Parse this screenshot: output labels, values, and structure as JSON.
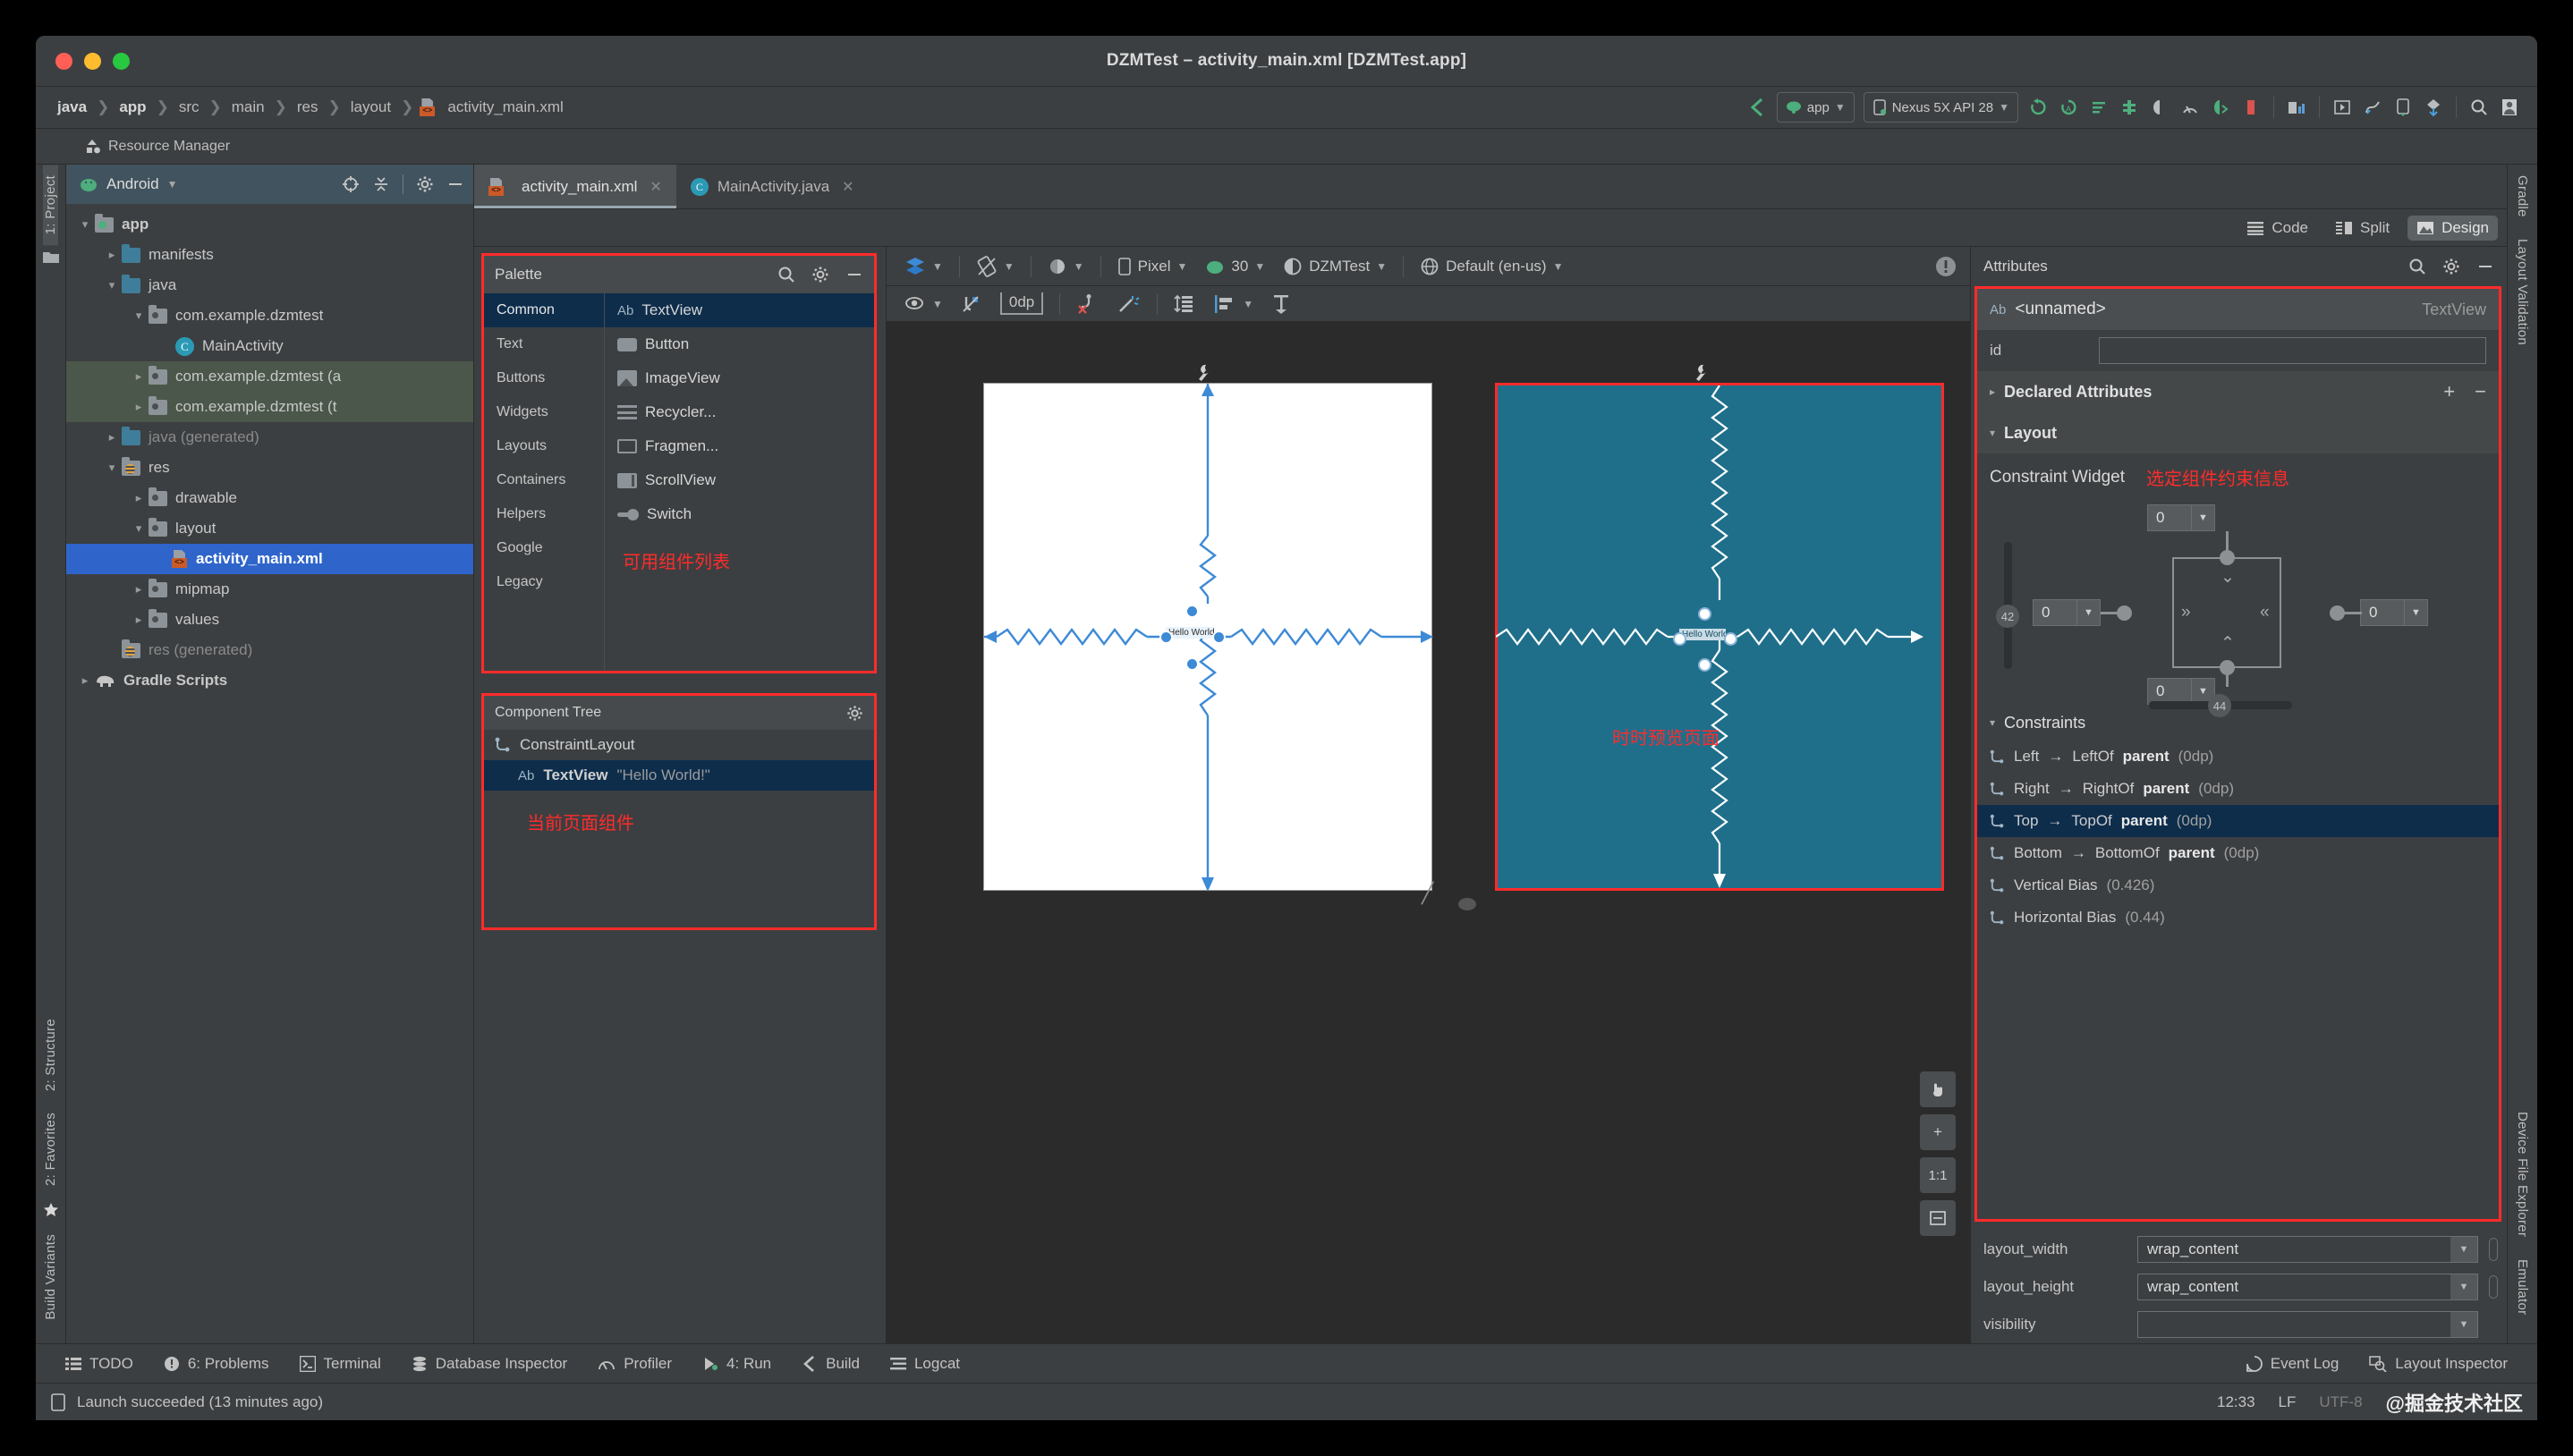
{
  "window": {
    "title": "DZMTest – activity_main.xml [DZMTest.app]"
  },
  "breadcrumb": {
    "items": [
      "java",
      "app",
      "src",
      "main",
      "res",
      "layout",
      "activity_main.xml"
    ]
  },
  "main_toolbar": {
    "module_selector": "app",
    "device_selector": "Nexus 5X API 28"
  },
  "resource_manager": {
    "label": "Resource Manager"
  },
  "project_panel": {
    "title": "Android",
    "tree": [
      {
        "label": "app",
        "indent": 0,
        "chevron": "down",
        "icon": "module-folder",
        "bold": true
      },
      {
        "label": "manifests",
        "indent": 1,
        "chevron": "right",
        "icon": "folder-blue"
      },
      {
        "label": "java",
        "indent": 1,
        "chevron": "down",
        "icon": "folder-blue"
      },
      {
        "label": "com.example.dzmtest",
        "indent": 2,
        "chevron": "down",
        "icon": "package"
      },
      {
        "label": "MainActivity",
        "indent": 3,
        "chevron": "none",
        "icon": "class"
      },
      {
        "label": "com.example.dzmtest (a",
        "indent": 2,
        "chevron": "right",
        "icon": "package",
        "vcs": true
      },
      {
        "label": "com.example.dzmtest (t",
        "indent": 2,
        "chevron": "right",
        "icon": "package",
        "vcs": true
      },
      {
        "label": "java (generated)",
        "indent": 1,
        "chevron": "right",
        "icon": "folder-gen",
        "dim": true
      },
      {
        "label": "res",
        "indent": 1,
        "chevron": "down",
        "icon": "folder-res"
      },
      {
        "label": "drawable",
        "indent": 2,
        "chevron": "right",
        "icon": "package"
      },
      {
        "label": "layout",
        "indent": 2,
        "chevron": "down",
        "icon": "package"
      },
      {
        "label": "activity_main.xml",
        "indent": 3,
        "chevron": "none",
        "icon": "xml",
        "selected": true
      },
      {
        "label": "mipmap",
        "indent": 2,
        "chevron": "right",
        "icon": "package"
      },
      {
        "label": "values",
        "indent": 2,
        "chevron": "right",
        "icon": "package"
      },
      {
        "label": "res (generated)",
        "indent": 1,
        "chevron": "none",
        "icon": "folder-res",
        "dim": true
      },
      {
        "label": "Gradle Scripts",
        "indent": 0,
        "chevron": "right",
        "icon": "gradle"
      }
    ]
  },
  "left_rail": {
    "tabs": [
      "1: Project",
      "2: Structure",
      "2: Favorites",
      "Build Variants"
    ]
  },
  "right_rail": {
    "tabs": [
      "Gradle",
      "Layout Validation",
      "Device File Explorer",
      "Emulator"
    ]
  },
  "editor_tabs": [
    {
      "label": "activity_main.xml",
      "icon": "xml-file-icon",
      "active": true
    },
    {
      "label": "MainActivity.java",
      "icon": "java-class-icon",
      "active": false
    }
  ],
  "view_modes": [
    {
      "label": "Code",
      "icon": "code-lines-icon",
      "active": false
    },
    {
      "label": "Split",
      "icon": "split-view-icon",
      "active": false
    },
    {
      "label": "Design",
      "icon": "design-image-icon",
      "active": true
    }
  ],
  "palette": {
    "title": "Palette",
    "annotation": "可用组件列表",
    "categories": [
      {
        "label": "Common",
        "active": true
      },
      {
        "label": "Text",
        "active": false
      },
      {
        "label": "Buttons",
        "active": false
      },
      {
        "label": "Widgets",
        "active": false
      },
      {
        "label": "Layouts",
        "active": false
      },
      {
        "label": "Containers",
        "active": false
      },
      {
        "label": "Helpers",
        "active": false
      },
      {
        "label": "Google",
        "active": false
      },
      {
        "label": "Legacy",
        "active": false
      }
    ],
    "items": [
      {
        "label": "TextView",
        "icon": "ab-text-icon",
        "active": true
      },
      {
        "label": "Button",
        "icon": "button-icon",
        "active": false
      },
      {
        "label": "ImageView",
        "icon": "image-icon",
        "active": false
      },
      {
        "label": "Recycler...",
        "icon": "list-icon",
        "active": false
      },
      {
        "label": "Fragmen...",
        "icon": "frame-icon",
        "active": false
      },
      {
        "label": "ScrollView",
        "icon": "scroll-icon",
        "active": false
      },
      {
        "label": "Switch",
        "icon": "switch-icon",
        "active": false
      }
    ]
  },
  "component_tree": {
    "title": "Component Tree",
    "annotation": "当前页面组件",
    "nodes": [
      {
        "label": "ConstraintLayout",
        "value": "",
        "icon": "constraint-icon",
        "indent": 0,
        "selected": false
      },
      {
        "label": "TextView",
        "value": "\"Hello World!\"",
        "icon": "ab-text-icon",
        "indent": 1,
        "selected": true
      }
    ]
  },
  "design_toolbar": {
    "device": "Pixel",
    "api_level": "30",
    "theme": "DZMTest",
    "locale": "Default (en-us)",
    "margin_value": "0dp"
  },
  "design_canvas": {
    "annotation": "时时预览页面",
    "textview_label": "Hello World!"
  },
  "attributes": {
    "title": "Attributes",
    "component_name": "<unnamed>",
    "component_type": "TextView",
    "id_label": "id",
    "id_value": "",
    "declared_attributes_label": "Declared Attributes",
    "layout_section_label": "Layout",
    "constraint_widget_label": "Constraint Widget",
    "constraint_annotation": "选定组件约束信息",
    "margins": {
      "top": "0",
      "left": "0",
      "right": "0",
      "bottom": "0"
    },
    "vertical_bias": "42",
    "horizontal_bias": "44",
    "constraints_label": "Constraints",
    "constraints": [
      {
        "side": "Left",
        "target": "LeftOf",
        "parent": "parent",
        "value": "(0dp)",
        "selected": false
      },
      {
        "side": "Right",
        "target": "RightOf",
        "parent": "parent",
        "value": "(0dp)",
        "selected": false
      },
      {
        "side": "Top",
        "target": "TopOf",
        "parent": "parent",
        "value": "(0dp)",
        "selected": true
      },
      {
        "side": "Bottom",
        "target": "BottomOf",
        "parent": "parent",
        "value": "(0dp)",
        "selected": false
      },
      {
        "side": "Vertical Bias",
        "target": "",
        "parent": "",
        "value": "(0.426)",
        "selected": false
      },
      {
        "side": "Horizontal Bias",
        "target": "",
        "parent": "",
        "value": "(0.44)",
        "selected": false
      }
    ],
    "properties": [
      {
        "name": "layout_width",
        "value": "wrap_content",
        "has_pill": true
      },
      {
        "name": "layout_height",
        "value": "wrap_content",
        "has_pill": true
      },
      {
        "name": "visibility",
        "value": "",
        "has_pill": false
      }
    ]
  },
  "tool_windows": [
    {
      "label": "TODO",
      "icon": "todo-icon"
    },
    {
      "label": "6: Problems",
      "icon": "problems-icon",
      "mnemonic": "6"
    },
    {
      "label": "Terminal",
      "icon": "terminal-icon"
    },
    {
      "label": "Database Inspector",
      "icon": "database-icon"
    },
    {
      "label": "Profiler",
      "icon": "profiler-icon"
    },
    {
      "label": "4: Run",
      "icon": "run-icon",
      "mnemonic": "4"
    },
    {
      "label": "Build",
      "icon": "build-icon"
    },
    {
      "label": "Logcat",
      "icon": "logcat-icon"
    }
  ],
  "tool_windows_right": [
    {
      "label": "Event Log",
      "icon": "event-log-icon"
    },
    {
      "label": "Layout Inspector",
      "icon": "layout-inspector-icon"
    }
  ],
  "status_bar": {
    "message": "Launch succeeded (13 minutes ago)",
    "time": "12:33",
    "line_separator": "LF",
    "encoding": "UTF-8",
    "watermark": "@掘金技术社区"
  },
  "colors": {
    "accent_red": "#ff2b2b",
    "selection_blue": "#2f65cb",
    "panel_header": "#41535e",
    "preview_blue": "#1f6f8b"
  }
}
